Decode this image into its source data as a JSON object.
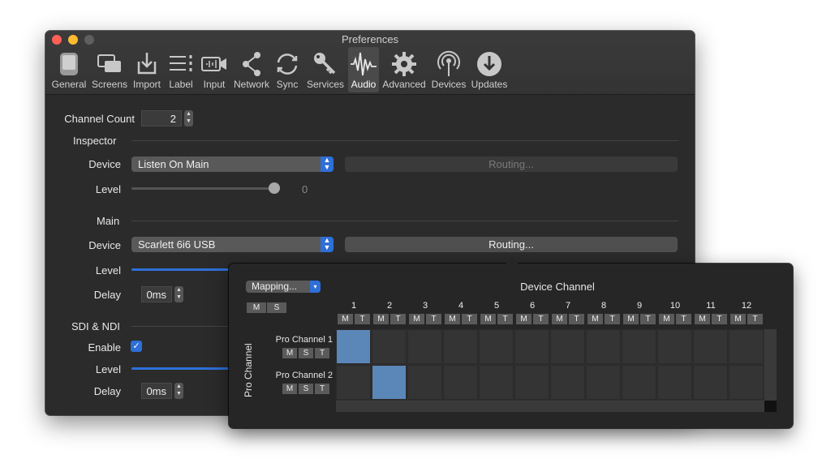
{
  "window": {
    "title": "Preferences"
  },
  "toolbar": [
    {
      "label": "General",
      "icon": "general-icon",
      "active": false
    },
    {
      "label": "Screens",
      "icon": "screens-icon",
      "active": false
    },
    {
      "label": "Import",
      "icon": "import-icon",
      "active": false
    },
    {
      "label": "Label",
      "icon": "label-icon",
      "active": false
    },
    {
      "label": "Input",
      "icon": "input-icon",
      "active": false
    },
    {
      "label": "Network",
      "icon": "network-icon",
      "active": false
    },
    {
      "label": "Sync",
      "icon": "sync-icon",
      "active": false
    },
    {
      "label": "Services",
      "icon": "services-icon",
      "active": false
    },
    {
      "label": "Audio",
      "icon": "audio-icon",
      "active": true
    },
    {
      "label": "Advanced",
      "icon": "advanced-icon",
      "active": false
    },
    {
      "label": "Devices",
      "icon": "devices-icon",
      "active": false
    },
    {
      "label": "Updates",
      "icon": "updates-icon",
      "active": false
    }
  ],
  "audio": {
    "channel_count_label": "Channel Count",
    "channel_count_value": "2",
    "inspector": {
      "title": "Inspector",
      "device_label": "Device",
      "device_value": "Listen On Main",
      "routing_label": "Routing...",
      "level_label": "Level",
      "level_value": "0"
    },
    "main": {
      "title": "Main",
      "device_label": "Device",
      "device_value": "Scarlett 6i6 USB",
      "routing_label": "Routing...",
      "level_label": "Level",
      "delay_label": "Delay",
      "delay_value": "0ms"
    },
    "sdi": {
      "title": "SDI & NDI",
      "enable_label": "Enable",
      "enable_checked": true,
      "level_label": "Level",
      "delay_label": "Delay",
      "delay_value": "0ms"
    }
  },
  "routing_popover": {
    "mapping_label": "Mapping...",
    "device_channel_title": "Device Channel",
    "pro_channel_title": "Pro Channel",
    "global_buttons": [
      "M",
      "S"
    ],
    "column_buttons": [
      "M",
      "T"
    ],
    "row_buttons": [
      "M",
      "S",
      "T"
    ],
    "columns": [
      "1",
      "2",
      "3",
      "4",
      "5",
      "6",
      "7",
      "8",
      "9",
      "10",
      "11",
      "12"
    ],
    "rows": [
      {
        "label": "Pro Channel 1",
        "mapped_column": 1
      },
      {
        "label": "Pro Channel 2",
        "mapped_column": 2
      }
    ],
    "colors": {
      "mapped_cell": "#5b86b8",
      "accent": "#2e6fd8"
    }
  }
}
